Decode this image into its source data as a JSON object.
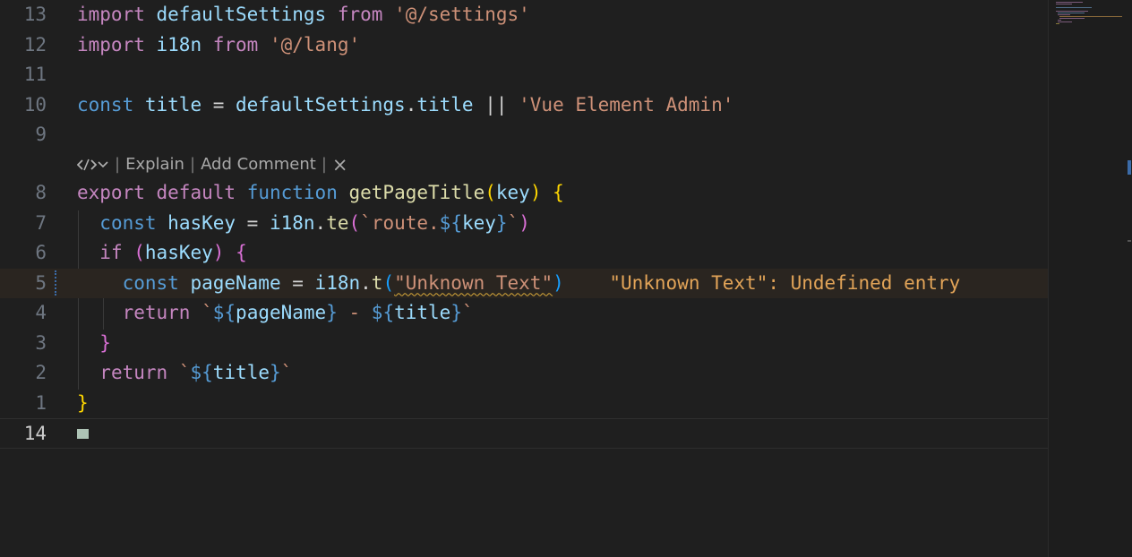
{
  "editor": {
    "lines": {
      "l13": {
        "num": "13"
      },
      "l12": {
        "num": "12"
      },
      "l11": {
        "num": "11"
      },
      "l10": {
        "num": "10"
      },
      "l9": {
        "num": "9"
      },
      "l8": {
        "num": "8"
      },
      "l7": {
        "num": "7"
      },
      "l6": {
        "num": "6"
      },
      "l5": {
        "num": "5"
      },
      "l4": {
        "num": "4"
      },
      "l3": {
        "num": "3"
      },
      "l2": {
        "num": "2"
      },
      "l1": {
        "num": "1"
      },
      "l14": {
        "num": "14"
      }
    },
    "tokens": {
      "import": "import",
      "from": "from",
      "defaultSettings": "defaultSettings",
      "settings_path": "'@/settings'",
      "i18n": "i18n",
      "lang_path": "'@/lang'",
      "const": "const",
      "title": "title",
      "eq": " = ",
      "dot": ".",
      "or": " || ",
      "app_name": "'Vue Element Admin'",
      "export": "export",
      "default": "default",
      "function": "function",
      "getPageTitle": "getPageTitle",
      "key": "key",
      "lparen": "(",
      "rparen": ")",
      "lbrace": "{",
      "rbrace": "}",
      "hasKey": "hasKey",
      "te": "te",
      "backtick": "`",
      "route_prefix": "route.",
      "tpl_open": "${",
      "tpl_close": "}",
      "if": "if",
      "pageName": "pageName",
      "t": "t",
      "unknown_text_arg": "\"Unknown Text\"",
      "return": "return",
      "dash": " - "
    },
    "inline_diagnostic": "\"Unknown Text\": Undefined entry",
    "codelens": {
      "explain": "Explain",
      "add_comment": "Add Comment",
      "separator": "|",
      "close_glyph": "×"
    }
  },
  "colors": {
    "background": "#1f1f1f",
    "keyword_control": "#c586c0",
    "keyword_storage": "#569cd6",
    "variable": "#9cdcfe",
    "function": "#dcdcaa",
    "string": "#ce9178",
    "warning": "#e2a458"
  }
}
